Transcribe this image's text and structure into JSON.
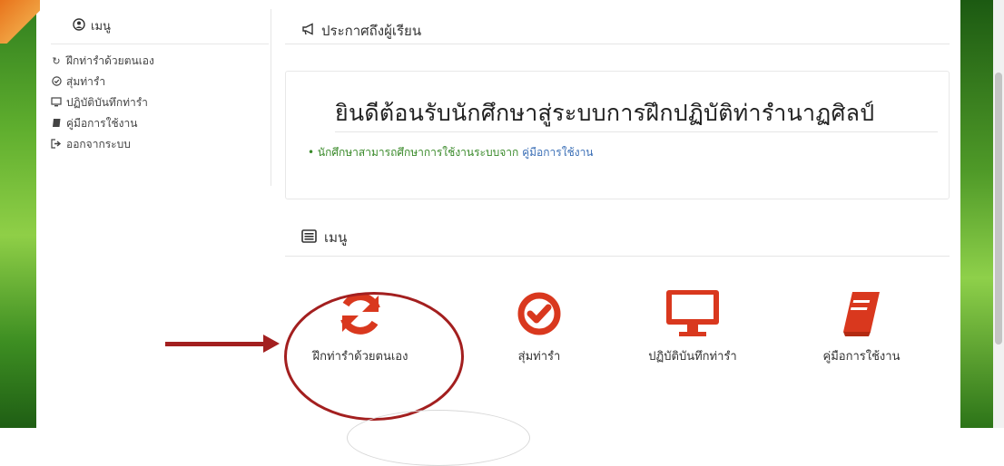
{
  "sidebar": {
    "title": "เมนู",
    "items": [
      {
        "label": "ฝึกท่ารำด้วยตนเอง",
        "icon": "refresh-icon"
      },
      {
        "label": "สุ่มท่ารำ",
        "icon": "check-circle-icon"
      },
      {
        "label": "ปฏิบัติบันทึกท่ารำ",
        "icon": "monitor-icon"
      },
      {
        "label": "คู่มือการใช้งาน",
        "icon": "book-icon"
      },
      {
        "label": "ออกจากระบบ",
        "icon": "sign-out-icon"
      }
    ]
  },
  "announcement": {
    "title": "ประกาศถึงผู้เรียน",
    "welcome": "ยินดีต้อนรับนักศึกษาสู่ระบบการฝึกปฏิบัติท่ารำนาฏศิลป์",
    "note_text": "นักศึกษาสามารถศึกษาการใช้งานระบบจาก",
    "note_link": "คู่มือการใช้งาน"
  },
  "menu": {
    "title": "เมนู",
    "tiles": [
      {
        "label": "ฝึกท่ารำด้วยตนเอง",
        "icon": "refresh-icon"
      },
      {
        "label": "สุ่มท่ารำ",
        "icon": "check-circle-icon"
      },
      {
        "label": "ปฏิบัติบันทึกท่ารำ",
        "icon": "monitor-icon"
      },
      {
        "label": "คู่มือการใช้งาน",
        "icon": "book-icon"
      }
    ]
  },
  "colors": {
    "accent_red": "#d9381e",
    "annotation_red": "#a31f1f",
    "note_green": "#3a8a2a",
    "link_blue": "#3b6fb6"
  }
}
